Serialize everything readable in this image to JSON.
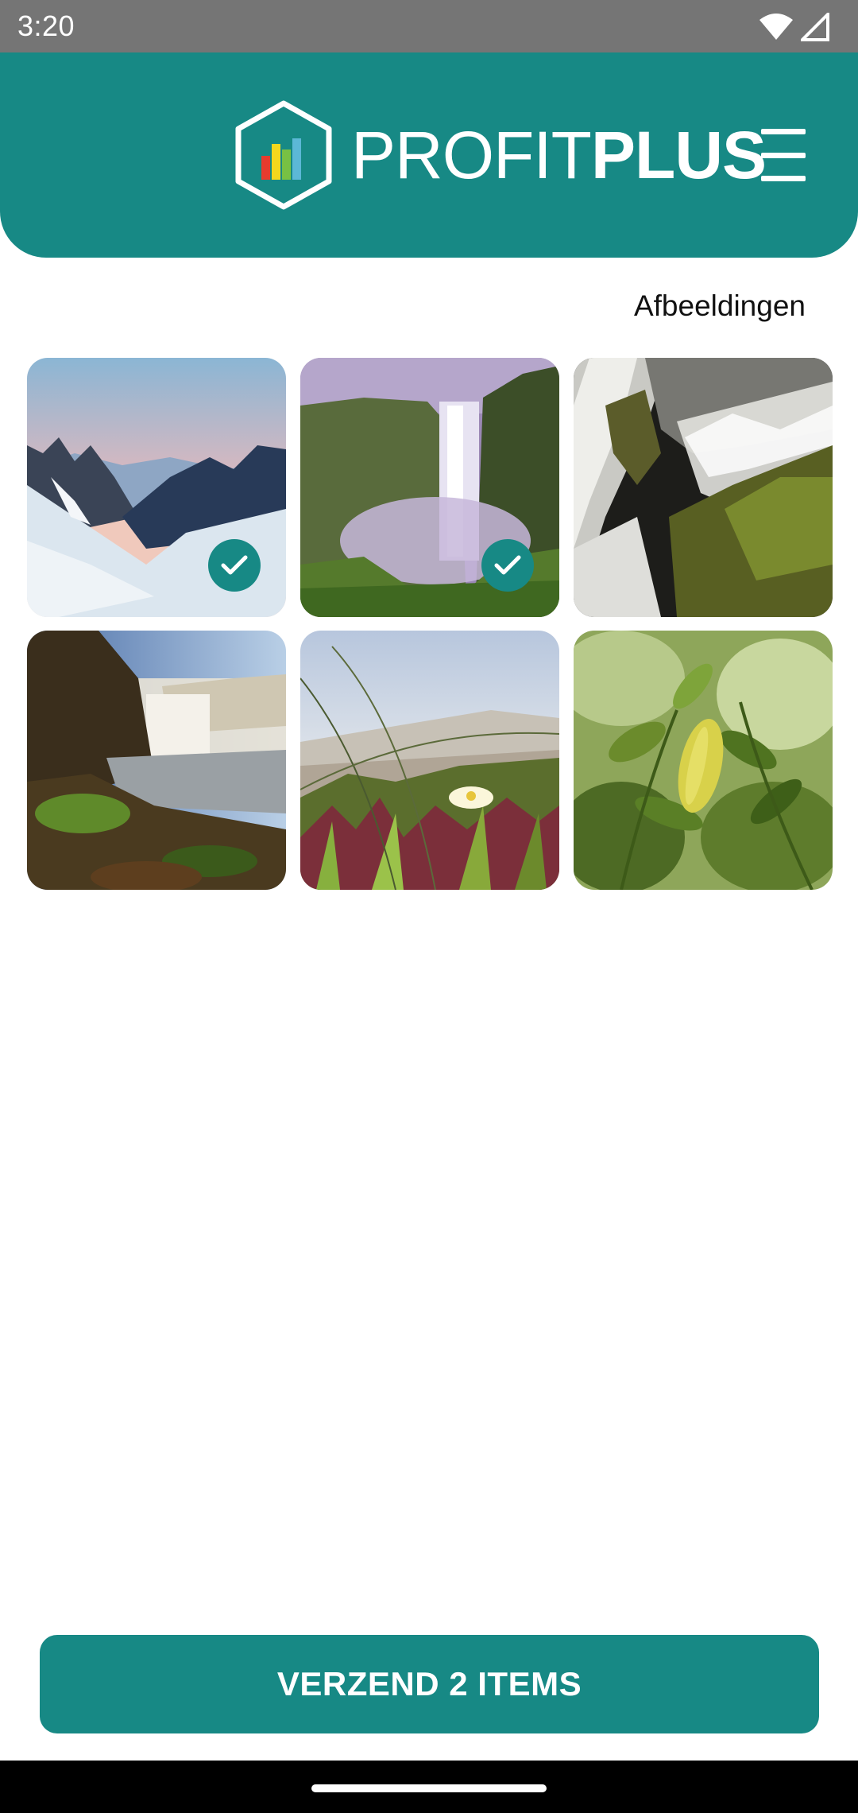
{
  "status_bar": {
    "time": "3:20",
    "icons": [
      "wifi-icon",
      "cell-signal-icon"
    ]
  },
  "header": {
    "logo_text_light": "PROFIT",
    "logo_text_bold": "PLUS",
    "logo_icon": "bar-chart-hexagon-icon",
    "menu_icon": "hamburger-menu-icon",
    "brand_color": "#178985"
  },
  "gallery": {
    "title": "Afbeeldingen",
    "images": [
      {
        "subject": "snowy mountains at dusk",
        "selected": true
      },
      {
        "subject": "waterfall in green valley",
        "selected": true
      },
      {
        "subject": "waterfall over mossy rocks",
        "selected": false
      },
      {
        "subject": "misty waterfall and rocky shore",
        "selected": false
      },
      {
        "subject": "white flower in dune grass",
        "selected": false
      },
      {
        "subject": "yellow leaf on green plant",
        "selected": false
      }
    ]
  },
  "actions": {
    "send_label": "VERZEND 2 ITEMS"
  }
}
